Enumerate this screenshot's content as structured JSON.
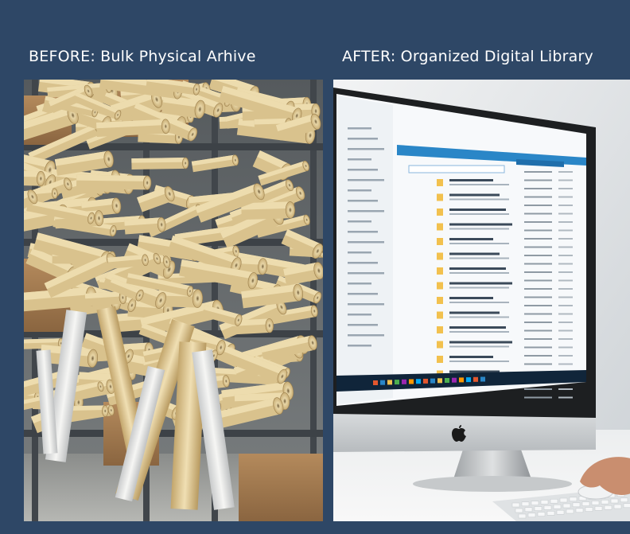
{
  "before": {
    "title": "BEFORE: Bulk Physical Arhive"
  },
  "after": {
    "title": "AFTER: Organized Digital Library"
  },
  "colors": {
    "background": "#2e4766",
    "title_text": "#ffffff",
    "paper": "#e3cf9e",
    "shelf": "#4a5056",
    "cardboard": "#a57a4f",
    "screen_accent": "#2a86c7"
  },
  "icons": [
    "apple-logo-icon",
    "folder-icon",
    "search-icon"
  ]
}
